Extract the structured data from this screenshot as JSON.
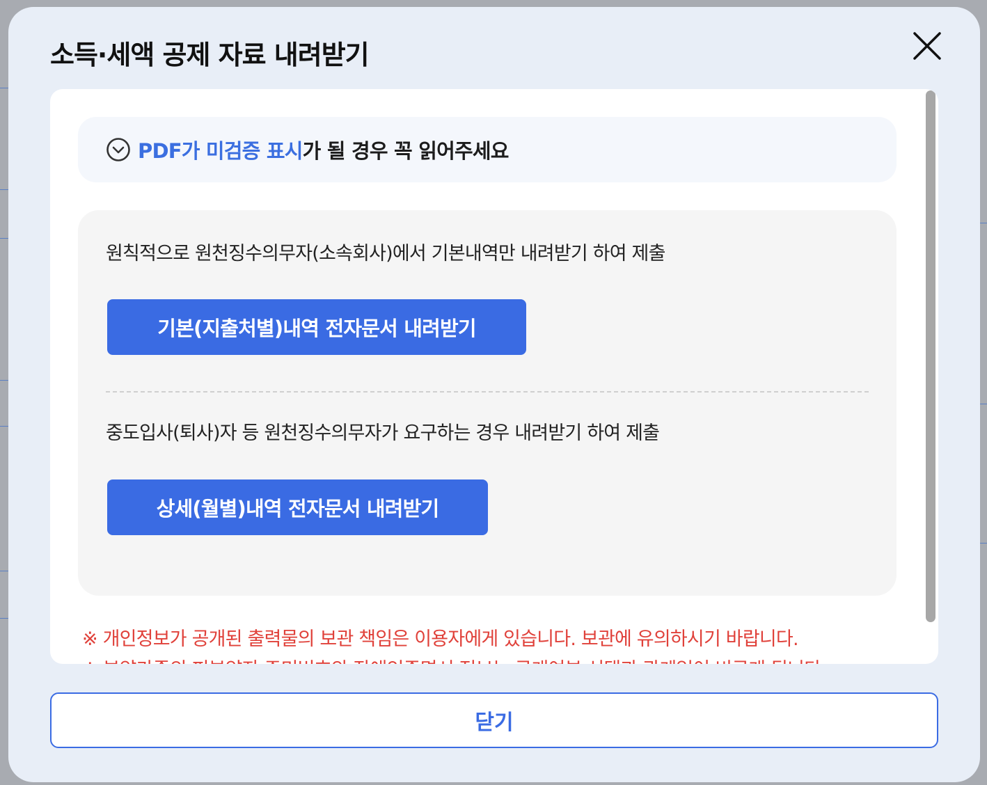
{
  "modal": {
    "title": "소득·세액 공제 자료 내려받기",
    "close_icon": "close-icon"
  },
  "notice": {
    "icon": "chevron-down-circle-icon",
    "highlight": "PDF가 미검증 표시",
    "rest": "가 될 경우 꼭 읽어주세요"
  },
  "section_basic": {
    "description": "원칙적으로 원천징수의무자(소속회사)에서 기본내역만 내려받기 하여 제출",
    "button_label": "기본(지출처별)내역 전자문서 내려받기"
  },
  "section_detail": {
    "description": "중도입사(퇴사)자 등 원천징수의무자가 요구하는 경우 내려받기 하여 제출",
    "button_label": "상세(월별)내역 전자문서 내려받기"
  },
  "warnings": [
    "※ 개인정보가 공개된 출력물의 보관 책임은 이용자에게 있습니다. 보관에 유의하시기 바랍니다.",
    "※ 부양가족의 피부양자 주민번호와 장애인증명서 정보는 공개여부 선택과 관계없이 비공개 됩니다."
  ],
  "footer": {
    "close_label": "닫기"
  },
  "colors": {
    "accent": "#3a6be3",
    "warning": "#e0413a",
    "modal_bg": "#e8eef7"
  }
}
